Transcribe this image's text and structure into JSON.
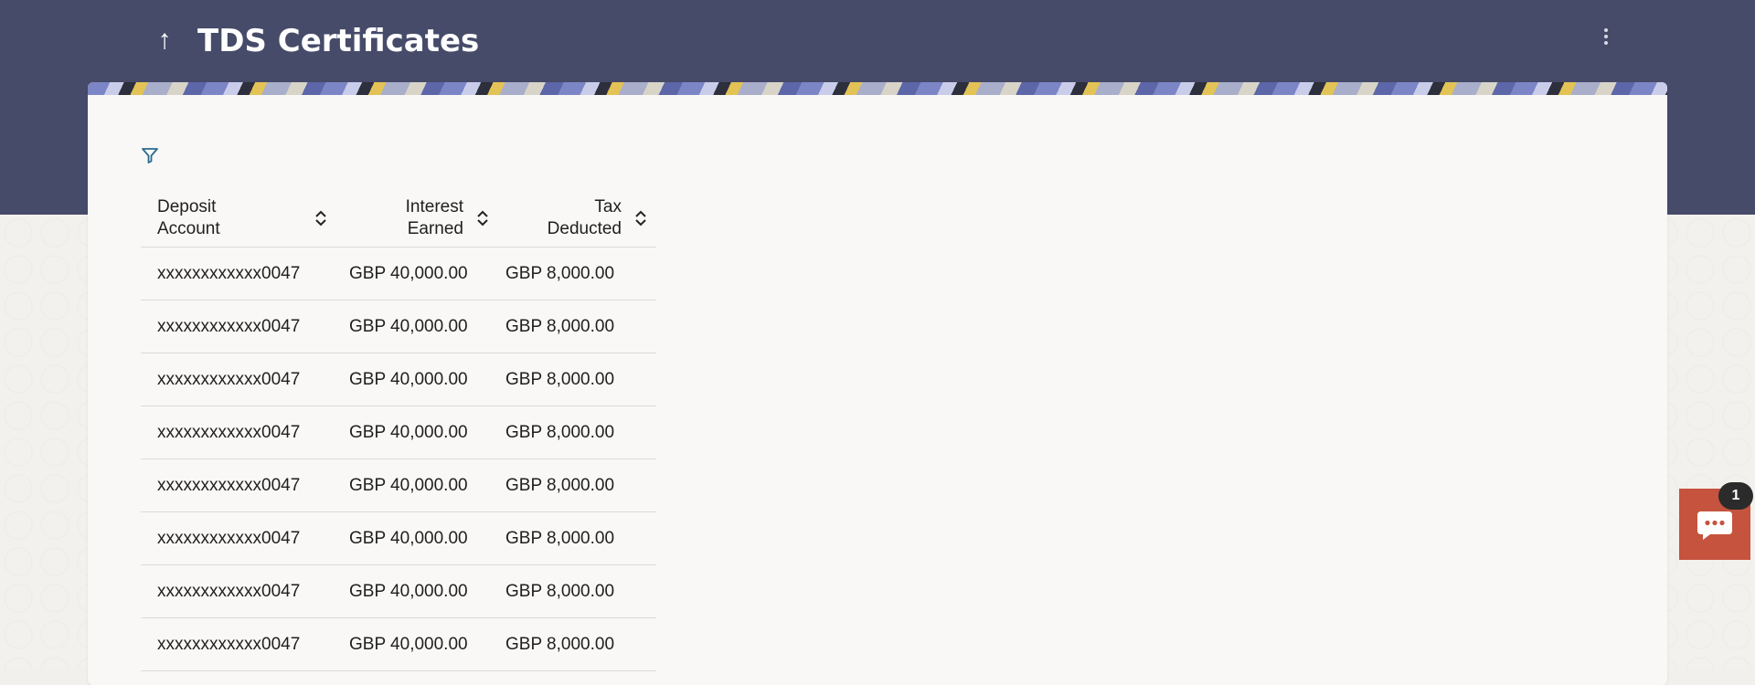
{
  "header": {
    "title": "TDS Certificates",
    "back_icon": "arrow-up-icon",
    "menu_icon": "kebab-menu-icon",
    "background_color": "#464b69"
  },
  "toolbar": {
    "filter_icon": "filter-icon"
  },
  "table": {
    "columns": [
      {
        "line1": "Deposit",
        "line2": "Account"
      },
      {
        "line1": "Interest",
        "line2": "Earned"
      },
      {
        "line1": "Tax",
        "line2": "Deducted"
      }
    ],
    "rows": [
      {
        "account": "xxxxxxxxxxxx0047",
        "interest": "GBP 40,000.00",
        "tax": "GBP 8,000.00"
      },
      {
        "account": "xxxxxxxxxxxx0047",
        "interest": "GBP 40,000.00",
        "tax": "GBP 8,000.00"
      },
      {
        "account": "xxxxxxxxxxxx0047",
        "interest": "GBP 40,000.00",
        "tax": "GBP 8,000.00"
      },
      {
        "account": "xxxxxxxxxxxx0047",
        "interest": "GBP 40,000.00",
        "tax": "GBP 8,000.00"
      },
      {
        "account": "xxxxxxxxxxxx0047",
        "interest": "GBP 40,000.00",
        "tax": "GBP 8,000.00"
      },
      {
        "account": "xxxxxxxxxxxx0047",
        "interest": "GBP 40,000.00",
        "tax": "GBP 8,000.00"
      },
      {
        "account": "xxxxxxxxxxxx0047",
        "interest": "GBP 40,000.00",
        "tax": "GBP 8,000.00"
      },
      {
        "account": "xxxxxxxxxxxx0047",
        "interest": "GBP 40,000.00",
        "tax": "GBP 8,000.00"
      }
    ]
  },
  "chat": {
    "icon": "chat-bubble-icon",
    "badge_count": "1",
    "color": "#c5533e"
  }
}
